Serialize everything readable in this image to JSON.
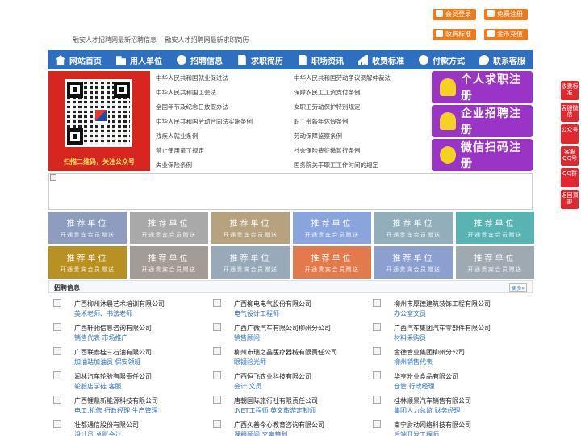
{
  "top": {
    "links": [
      "融安人才招聘网最新招聘信息",
      "融安人才招聘网最新求职简历"
    ],
    "buttons": [
      "会员登录",
      "免费注册",
      "收费标准",
      "金币充值"
    ]
  },
  "nav": {
    "items": [
      {
        "label": "网站首页",
        "icon": "home-icon"
      },
      {
        "label": "用人单位",
        "icon": "building-icon"
      },
      {
        "label": "招聘信息",
        "icon": "megaphone-icon"
      },
      {
        "label": "求职简历",
        "icon": "resume-icon"
      },
      {
        "label": "职场资讯",
        "icon": "news-icon"
      },
      {
        "label": "收费标准",
        "icon": "chart-icon"
      },
      {
        "label": "付款方式",
        "icon": "yuan-icon"
      },
      {
        "label": "联系客服",
        "icon": "chat-icon"
      }
    ]
  },
  "qr": {
    "caption": "扫描二维码，关注公众号"
  },
  "laws": {
    "left": [
      "中华人民共和国就业促进法",
      "中华人民共和国工会法",
      "全国年节及纪念日放假办法",
      "中华人民共和国劳动合同法实施条例",
      "残疾人就业条例",
      "禁止使用童工规定",
      "失业保险条例"
    ],
    "right": [
      "中华人民共和国劳动争议调解仲裁法",
      "保障农民工工资支付条例",
      "女职工劳动保护特别规定",
      "职工带薪年休假条例",
      "劳动保障监察条例",
      "社会保险费征缴暂行条例",
      "国务院关于职工工作时间的规定"
    ]
  },
  "register": [
    "个人求职注册",
    "企业招聘注册",
    "微信扫码注册"
  ],
  "recommend": {
    "title": "推荐单位",
    "subtitle": "开通贵宾会员赠送"
  },
  "recommend_colors": [
    "#8e9cbf",
    "#a9a9a9",
    "#b7a27f",
    "#8aa5de",
    "#93aebb",
    "#5ab3b3",
    "#b99022",
    "#a39b95",
    "#98aab9",
    "#e27a4c",
    "#8ca0cf",
    "#9ea9b2"
  ],
  "jobs": {
    "title": "招聘信息",
    "more": "更多»",
    "items": [
      {
        "company": "广西柳州沐晨艺术培训有限公司",
        "positions": "美术老师、书法老师"
      },
      {
        "company": "广西柳电电气股份有限公司",
        "positions": "电气设计工程师"
      },
      {
        "company": "柳州市厚德建筑装饰工程有限公司",
        "positions": "办公室文员"
      },
      {
        "company": "广西轩驰信息咨询有限公司",
        "positions": "销售代表 市场推广"
      },
      {
        "company": "广西广微汽车有限公司柳州分公司",
        "positions": "销售顾问"
      },
      {
        "company": "广西汽车集团汽车零部件有限公司",
        "positions": "材料采购员"
      },
      {
        "company": "广西联泰桂三石油有限公司",
        "positions": "加油站加油员 保安领班"
      },
      {
        "company": "柳州市瑞之晶医疗器械有限责任公司",
        "positions": "眼镜验光师"
      },
      {
        "company": "金德管业集团柳州分公司",
        "positions": "柳州销售代表"
      },
      {
        "company": "润林汽车轮胎有限责任公司",
        "positions": "轮胎店学徒 客服"
      },
      {
        "company": "广西恒飞农业科技有限公司",
        "positions": "会计 文员"
      },
      {
        "company": "华亨粉业食品有限公司",
        "positions": "仓管 行政经理"
      },
      {
        "company": "广西锂鼎新能源科技有限公司",
        "positions": "电工.机修 行政经理 生产管理"
      },
      {
        "company": "唐朝国际旅行社有限责任公司",
        "positions": ".NET工程师 英文旅游定制师"
      },
      {
        "company": "桂林顺景汽车销售有限公司",
        "positions": "集团人力总监 财务经理"
      },
      {
        "company": "壮都通信股份有限公司",
        "positions": "设计员 总账会计"
      },
      {
        "company": "广西久善今心教育咨询有限公司",
        "positions": "课程顾问 文案策划"
      },
      {
        "company": "南宁尉动网络科技有限公司",
        "positions": "后端开发工程师"
      }
    ]
  },
  "side": [
    "收费标准",
    "客服微信",
    "公众号",
    "客服QQ号",
    "QQ群",
    "返回顶部"
  ]
}
